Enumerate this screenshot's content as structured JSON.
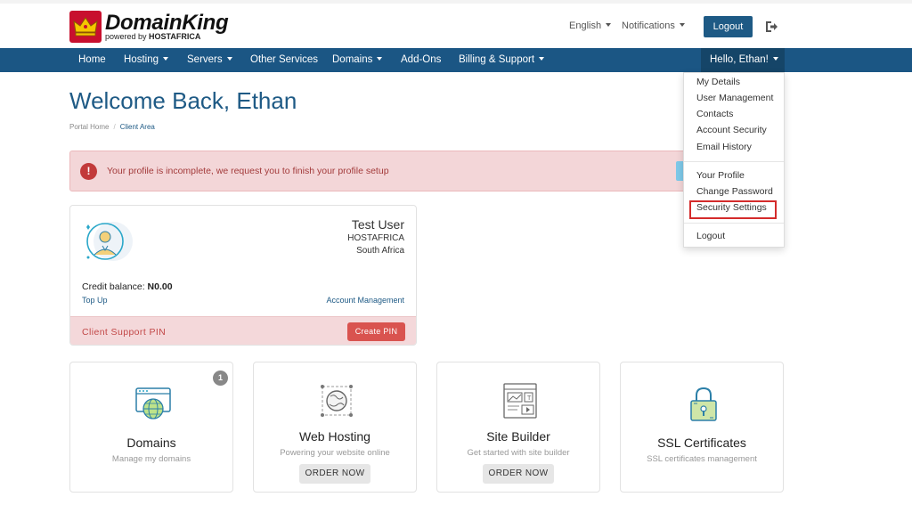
{
  "brand": {
    "name": "DomainKing",
    "sub_prefix": "powered by",
    "sub_brand": "HOSTAFRICA",
    "logo_red": "#c8102e",
    "crown_yellow": "#f6c700"
  },
  "header": {
    "language": "English",
    "notifications": "Notifications",
    "logout": "Logout",
    "signout_icon": "sign-out-icon"
  },
  "nav": {
    "items": [
      "Home",
      "Hosting",
      "Servers",
      "Other Services",
      "Domains",
      "Add-Ons",
      "Billing & Support"
    ],
    "greeting": "Hello, Ethan!",
    "color": "#1b5684"
  },
  "page": {
    "title": "Welcome Back, Ethan",
    "breadcrumb": [
      "Portal Home",
      "Client Area"
    ]
  },
  "alert": {
    "text": "Your profile is incomplete, we request you to finish your profile setup",
    "icon": "exclamation-circle-icon"
  },
  "profile": {
    "name": "Test User",
    "company": "HOSTAFRICA",
    "country": "South Africa",
    "credit_label": "Credit balance:",
    "credit_value": "N0.00",
    "top_up": "Top Up",
    "account_management": "Account Management",
    "pin_label": "Client Support PIN",
    "create_pin": "Create PIN"
  },
  "dropdown": {
    "group1": [
      "My Details",
      "User Management",
      "Contacts",
      "Account Security",
      "Email History"
    ],
    "group2": [
      "Your Profile",
      "Change Password",
      "Security Settings"
    ],
    "logout": "Logout",
    "highlighted": "Security Settings"
  },
  "services": [
    {
      "title": "Domains",
      "desc": "Manage my domains",
      "badge": "1",
      "icon": "domain-globe-icon"
    },
    {
      "title": "Web Hosting",
      "desc": "Powering your website online",
      "button": "ORDER NOW",
      "icon": "globe-network-icon"
    },
    {
      "title": "Site Builder",
      "desc": "Get started with site builder",
      "button": "ORDER NOW",
      "icon": "site-builder-icon"
    },
    {
      "title": "SSL Certificates",
      "desc": "SSL certificates management",
      "icon": "ssl-lock-icon"
    }
  ]
}
